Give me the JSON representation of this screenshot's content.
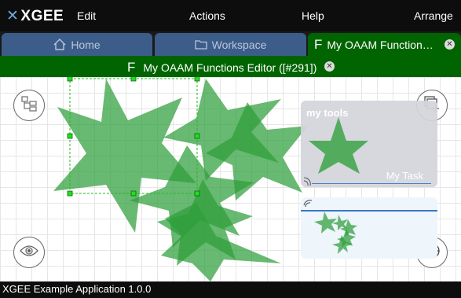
{
  "app": {
    "logo_mark": "✕",
    "logo_text": "XGEE"
  },
  "menu": {
    "edit": "Edit",
    "actions": "Actions",
    "help": "Help",
    "arrange": "Arrange"
  },
  "tabs": [
    {
      "label": "Home",
      "icon": "home-icon"
    },
    {
      "label": "Workspace",
      "icon": "folder-icon"
    },
    {
      "label": "My OAAM Function…",
      "icon": "F",
      "active": true
    }
  ],
  "editor": {
    "icon": "F",
    "title": "My OAAM Functions Editor ([#291])"
  },
  "palette": {
    "title": "my tools",
    "item": "My Task"
  },
  "status": {
    "text": "XGEE Example Application 1.0.0"
  },
  "colors": {
    "accent_green": "#006400",
    "tab_blue": "#3c5d8a",
    "star_green": "#2e9e3a"
  }
}
